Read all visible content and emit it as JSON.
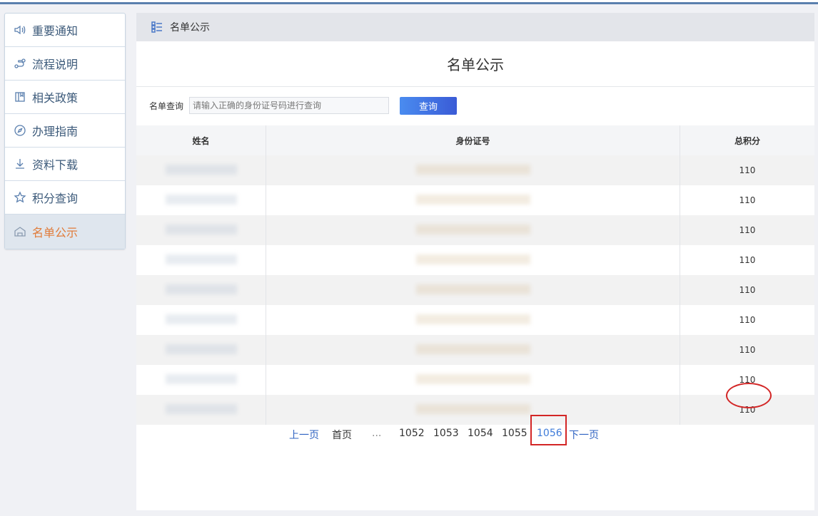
{
  "sidebar": {
    "items": [
      {
        "label": "重要通知",
        "icon": "speaker-icon",
        "active": false
      },
      {
        "label": "流程说明",
        "icon": "flow-icon",
        "active": false
      },
      {
        "label": "相关政策",
        "icon": "book-icon",
        "active": false
      },
      {
        "label": "办理指南",
        "icon": "compass-icon",
        "active": false
      },
      {
        "label": "资料下载",
        "icon": "download-icon",
        "active": false
      },
      {
        "label": "积分查询",
        "icon": "star-icon",
        "active": false
      },
      {
        "label": "名单公示",
        "icon": "home-icon",
        "active": true
      }
    ]
  },
  "header": {
    "title": "名单公示",
    "icon": "list-icon"
  },
  "main": {
    "title": "名单公示",
    "search": {
      "label": "名单查询",
      "placeholder": "请输入正确的身份证号码进行查询",
      "button": "查询"
    },
    "table": {
      "columns": [
        "姓名",
        "身份证号",
        "总积分"
      ],
      "rows": [
        {
          "name": "",
          "id": "",
          "score": "110"
        },
        {
          "name": "",
          "id": "",
          "score": "110"
        },
        {
          "name": "",
          "id": "",
          "score": "110"
        },
        {
          "name": "",
          "id": "",
          "score": "110"
        },
        {
          "name": "",
          "id": "",
          "score": "110"
        },
        {
          "name": "",
          "id": "",
          "score": "110"
        },
        {
          "name": "",
          "id": "",
          "score": "110"
        },
        {
          "name": "",
          "id": "",
          "score": "110"
        },
        {
          "name": "",
          "id": "",
          "score": "110"
        }
      ]
    },
    "pager": {
      "prev": "上一页",
      "first": "首页",
      "ellipsis": "...",
      "pages": [
        "1052",
        "1053",
        "1054",
        "1055"
      ],
      "current": "1056",
      "next": "下一页"
    }
  },
  "colors": {
    "accent": "#3e7bd9",
    "active_text": "#e07b39",
    "highlight": "#d32626"
  }
}
